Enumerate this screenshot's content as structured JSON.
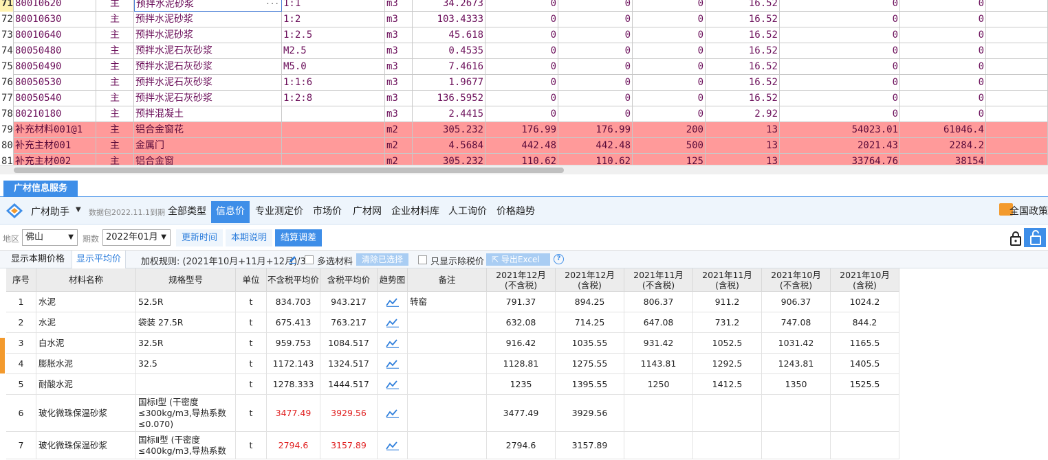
{
  "top_grid": {
    "rows": [
      {
        "n": "71",
        "code": "80010620",
        "type": "主",
        "name": "预拌水泥砂浆",
        "spec": "1:1",
        "unit": "m3",
        "qty": "34.2673",
        "c1": "0",
        "c2": "0",
        "c3": "0",
        "c4": "16.52",
        "c5": "0",
        "c6": "0",
        "pink": false,
        "selected": true
      },
      {
        "n": "72",
        "code": "80010630",
        "type": "主",
        "name": "预拌水泥砂浆",
        "spec": "1:2",
        "unit": "m3",
        "qty": "103.4333",
        "c1": "0",
        "c2": "0",
        "c3": "0",
        "c4": "16.52",
        "c5": "0",
        "c6": "0",
        "pink": false
      },
      {
        "n": "73",
        "code": "80010640",
        "type": "主",
        "name": "预拌水泥砂浆",
        "spec": "1:2.5",
        "unit": "m3",
        "qty": "45.618",
        "c1": "0",
        "c2": "0",
        "c3": "0",
        "c4": "16.52",
        "c5": "0",
        "c6": "0",
        "pink": false
      },
      {
        "n": "74",
        "code": "80050480",
        "type": "主",
        "name": "预拌水泥石灰砂浆",
        "spec": "M2.5",
        "unit": "m3",
        "qty": "0.4535",
        "c1": "0",
        "c2": "0",
        "c3": "0",
        "c4": "16.52",
        "c5": "0",
        "c6": "0",
        "pink": false
      },
      {
        "n": "75",
        "code": "80050490",
        "type": "主",
        "name": "预拌水泥石灰砂浆",
        "spec": "M5.0",
        "unit": "m3",
        "qty": "7.4616",
        "c1": "0",
        "c2": "0",
        "c3": "0",
        "c4": "16.52",
        "c5": "0",
        "c6": "0",
        "pink": false
      },
      {
        "n": "76",
        "code": "80050530",
        "type": "主",
        "name": "预拌水泥石灰砂浆",
        "spec": "1:1:6",
        "unit": "m3",
        "qty": "1.9677",
        "c1": "0",
        "c2": "0",
        "c3": "0",
        "c4": "16.52",
        "c5": "0",
        "c6": "0",
        "pink": false
      },
      {
        "n": "77",
        "code": "80050540",
        "type": "主",
        "name": "预拌水泥石灰砂浆",
        "spec": "1:2:8",
        "unit": "m3",
        "qty": "136.5952",
        "c1": "0",
        "c2": "0",
        "c3": "0",
        "c4": "16.52",
        "c5": "0",
        "c6": "0",
        "pink": false
      },
      {
        "n": "78",
        "code": "80210180",
        "type": "主",
        "name": "预拌混凝土",
        "spec": "",
        "unit": "m3",
        "qty": "2.4415",
        "c1": "0",
        "c2": "0",
        "c3": "0",
        "c4": "2.92",
        "c5": "0",
        "c6": "0",
        "pink": false
      },
      {
        "n": "79",
        "code": "补充材料001@1",
        "type": "主",
        "name": "铝合金窗花",
        "spec": "",
        "unit": "m2",
        "qty": "305.232",
        "c1": "176.99",
        "c2": "176.99",
        "c3": "200",
        "c4": "13",
        "c5": "54023.01",
        "c6": "61046.4",
        "pink": true
      },
      {
        "n": "80",
        "code": "补充主材001",
        "type": "主",
        "name": "金属门",
        "spec": "",
        "unit": "m2",
        "qty": "4.5684",
        "c1": "442.48",
        "c2": "442.48",
        "c3": "500",
        "c4": "13",
        "c5": "2021.43",
        "c6": "2284.2",
        "pink": true
      },
      {
        "n": "81",
        "code": "补充主材002",
        "type": "主",
        "name": "铝合金窗",
        "spec": "",
        "unit": "m2",
        "qty": "305.232",
        "c1": "110.62",
        "c2": "110.62",
        "c3": "125",
        "c4": "13",
        "c5": "33764.76",
        "c6": "38154",
        "pink": true
      }
    ],
    "ellipsis": "···"
  },
  "panel_tab": "广材信息服务",
  "toolbar": {
    "app_name": "广材助手",
    "caret": "▼",
    "data_package": "数据包2022.11.1到期",
    "tabs": [
      "全部类型",
      "信息价",
      "专业测定价",
      "市场价",
      "广材网",
      "企业材料库",
      "人工询价",
      "价格趋势"
    ],
    "active_tab": "信息价",
    "policy": "全国政策"
  },
  "filters": {
    "region_label": "地区",
    "region_value": "佛山",
    "period_label": "期数",
    "period_value": "2022年01月",
    "btn_update": "更新时间",
    "btn_notes": "本期说明",
    "btn_settle": "结算调差"
  },
  "options": {
    "tab_current": "显示本期价格",
    "tab_avg": "显示平均价",
    "weight_rule": "加权规则: (2021年10月+11月+12月)/3",
    "multi_select": "多选材料",
    "clear_selected": "清除已选择",
    "pretax_only": "只显示除税价",
    "export": "导出Excel",
    "help": "?"
  },
  "table": {
    "headers": [
      "序号",
      "材料名称",
      "规格型号",
      "单位",
      "不含税平均价",
      "含税平均价",
      "趋势图",
      "备注",
      "2021年12月\n(不含税)",
      "2021年12月\n(含税)",
      "2021年11月\n(不含税)",
      "2021年11月\n(含税)",
      "2021年10月\n(不含税)",
      "2021年10月\n(含税)"
    ],
    "rows": [
      {
        "no": "1",
        "name": "水泥",
        "spec": "52.5R",
        "unit": "t",
        "avg_ex": "834.703",
        "avg_in": "943.217",
        "note": "转窑",
        "m12ex": "791.37",
        "m12in": "894.25",
        "m11ex": "806.37",
        "m11in": "911.2",
        "m10ex": "906.37",
        "m10in": "1024.2",
        "red": false
      },
      {
        "no": "2",
        "name": "水泥",
        "spec": "袋装 27.5R",
        "unit": "t",
        "avg_ex": "675.413",
        "avg_in": "763.217",
        "note": "",
        "m12ex": "632.08",
        "m12in": "714.25",
        "m11ex": "647.08",
        "m11in": "731.2",
        "m10ex": "747.08",
        "m10in": "844.2",
        "red": false
      },
      {
        "no": "3",
        "name": "白水泥",
        "spec": "32.5R",
        "unit": "t",
        "avg_ex": "959.753",
        "avg_in": "1084.517",
        "note": "",
        "m12ex": "916.42",
        "m12in": "1035.55",
        "m11ex": "931.42",
        "m11in": "1052.5",
        "m10ex": "1031.42",
        "m10in": "1165.5",
        "red": false
      },
      {
        "no": "4",
        "name": "膨胀水泥",
        "spec": "32.5",
        "unit": "t",
        "avg_ex": "1172.143",
        "avg_in": "1324.517",
        "note": "",
        "m12ex": "1128.81",
        "m12in": "1275.55",
        "m11ex": "1143.81",
        "m11in": "1292.5",
        "m10ex": "1243.81",
        "m10in": "1405.5",
        "red": false
      },
      {
        "no": "5",
        "name": "耐酸水泥",
        "spec": "",
        "unit": "t",
        "avg_ex": "1278.333",
        "avg_in": "1444.517",
        "note": "",
        "m12ex": "1235",
        "m12in": "1395.55",
        "m11ex": "1250",
        "m11in": "1412.5",
        "m10ex": "1350",
        "m10in": "1525.5",
        "red": false
      },
      {
        "no": "6",
        "name": "玻化微珠保温砂浆",
        "spec": "国标Ⅰ型 (干密度\n≤300kg/m3,导热系数\n≤0.070)",
        "unit": "t",
        "avg_ex": "3477.49",
        "avg_in": "3929.56",
        "note": "",
        "m12ex": "3477.49",
        "m12in": "3929.56",
        "m11ex": "",
        "m11in": "",
        "m10ex": "",
        "m10in": "",
        "red": true
      },
      {
        "no": "7",
        "name": "玻化微珠保温砂浆",
        "spec": "国标Ⅱ型 (干密度\n≤400kg/m3,导热系数",
        "unit": "t",
        "avg_ex": "2794.6",
        "avg_in": "3157.89",
        "note": "",
        "m12ex": "2794.6",
        "m12in": "3157.89",
        "m11ex": "",
        "m11in": "",
        "m10ex": "",
        "m10in": "",
        "red": true
      }
    ]
  },
  "colors": {
    "accent": "#3e8ee8",
    "pink_row": "#ff9a9a",
    "red_value": "#e02020",
    "brand_orange": "#f39a2d"
  }
}
